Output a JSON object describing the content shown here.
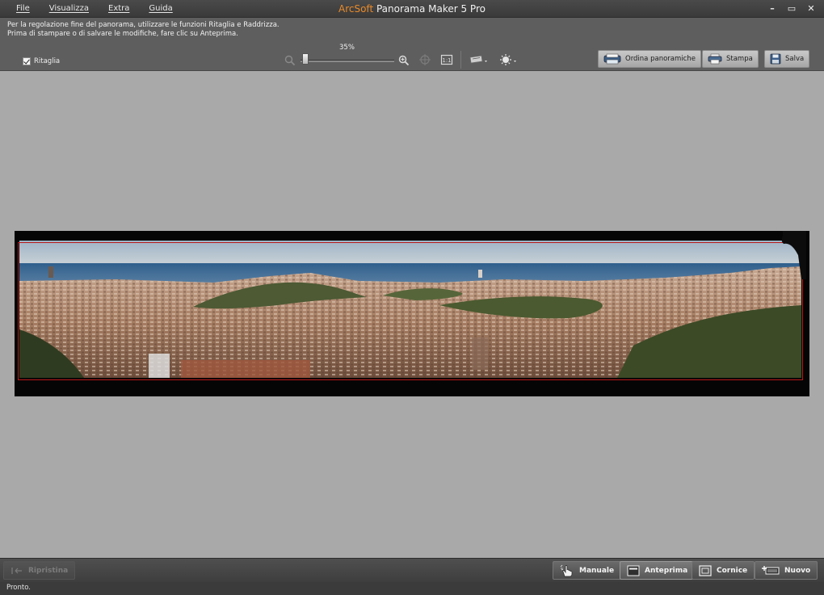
{
  "app": {
    "title_brand": "ArcSoft",
    "title_name": "Panorama Maker 5 Pro",
    "colors": {
      "brand": "#e88a2a",
      "crop_border": "#b81818",
      "canvas": "#a9a9a9"
    }
  },
  "menu": {
    "items": [
      {
        "label": "File"
      },
      {
        "label": "Visualizza"
      },
      {
        "label": "Extra"
      },
      {
        "label": "Guida"
      }
    ]
  },
  "window_controls": {
    "minimize": "–",
    "restore": "▭",
    "close": "✕"
  },
  "hint": {
    "line1": "Per la regolazione fine del panorama, utilizzare le funzioni Ritaglia e Raddrizza.",
    "line2": "Prima di stampare o di salvare le modifiche, fare clic su Anteprima."
  },
  "crop": {
    "label": "Ritaglia",
    "checked": true
  },
  "zoom": {
    "percent_label": "35%",
    "level": 0.35
  },
  "toolbar_buttons": {
    "order": "Ordina panoramiche",
    "print": "Stampa",
    "save": "Salva"
  },
  "bottom_buttons": {
    "restore": "Ripristina",
    "manual": "Manuale",
    "preview": "Anteprima",
    "frame": "Cornice",
    "new": "Nuovo"
  },
  "status": {
    "text": "Pronto."
  }
}
